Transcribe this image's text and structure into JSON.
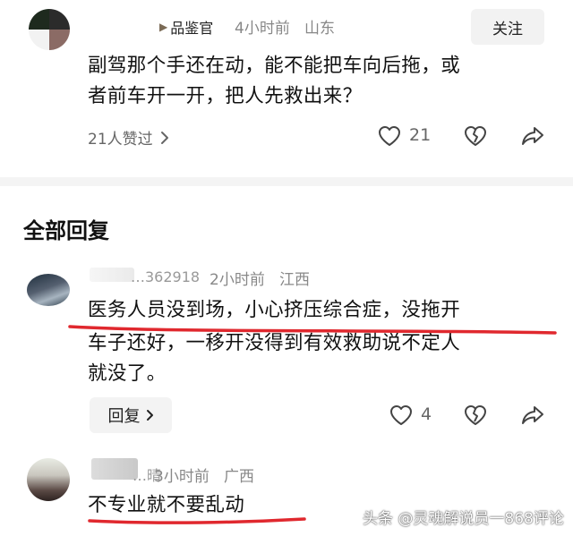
{
  "top_comment": {
    "user_name": "品鉴官",
    "time": "4小时前",
    "location": "山东",
    "follow_label": "关注",
    "text_line1": "副驾那个手还在动，能不能把车向后拖，或",
    "text_line2": "者前车开一开，把人先救出来？",
    "likes_link": "21人赞过",
    "like_count": "21"
  },
  "section_title": "全部回复",
  "replies": [
    {
      "user_name": "…362918",
      "time": "2小时前",
      "location": "江西",
      "text_line1": "医务人员没到场，小心挤压综合症，没拖开",
      "text_line2": "车子还好，一移开没得到有效救助说不定人",
      "text_line3": "就没了。",
      "reply_label": "回复",
      "like_count": "4"
    },
    {
      "user_name": "…晴",
      "time": "3小时前",
      "location": "广西",
      "text_line1": "不专业就不要乱动"
    }
  ],
  "watermark": "头条 @灵魂解说员一868评论",
  "colors": {
    "underline": "#e0282e",
    "muted": "#888888"
  }
}
